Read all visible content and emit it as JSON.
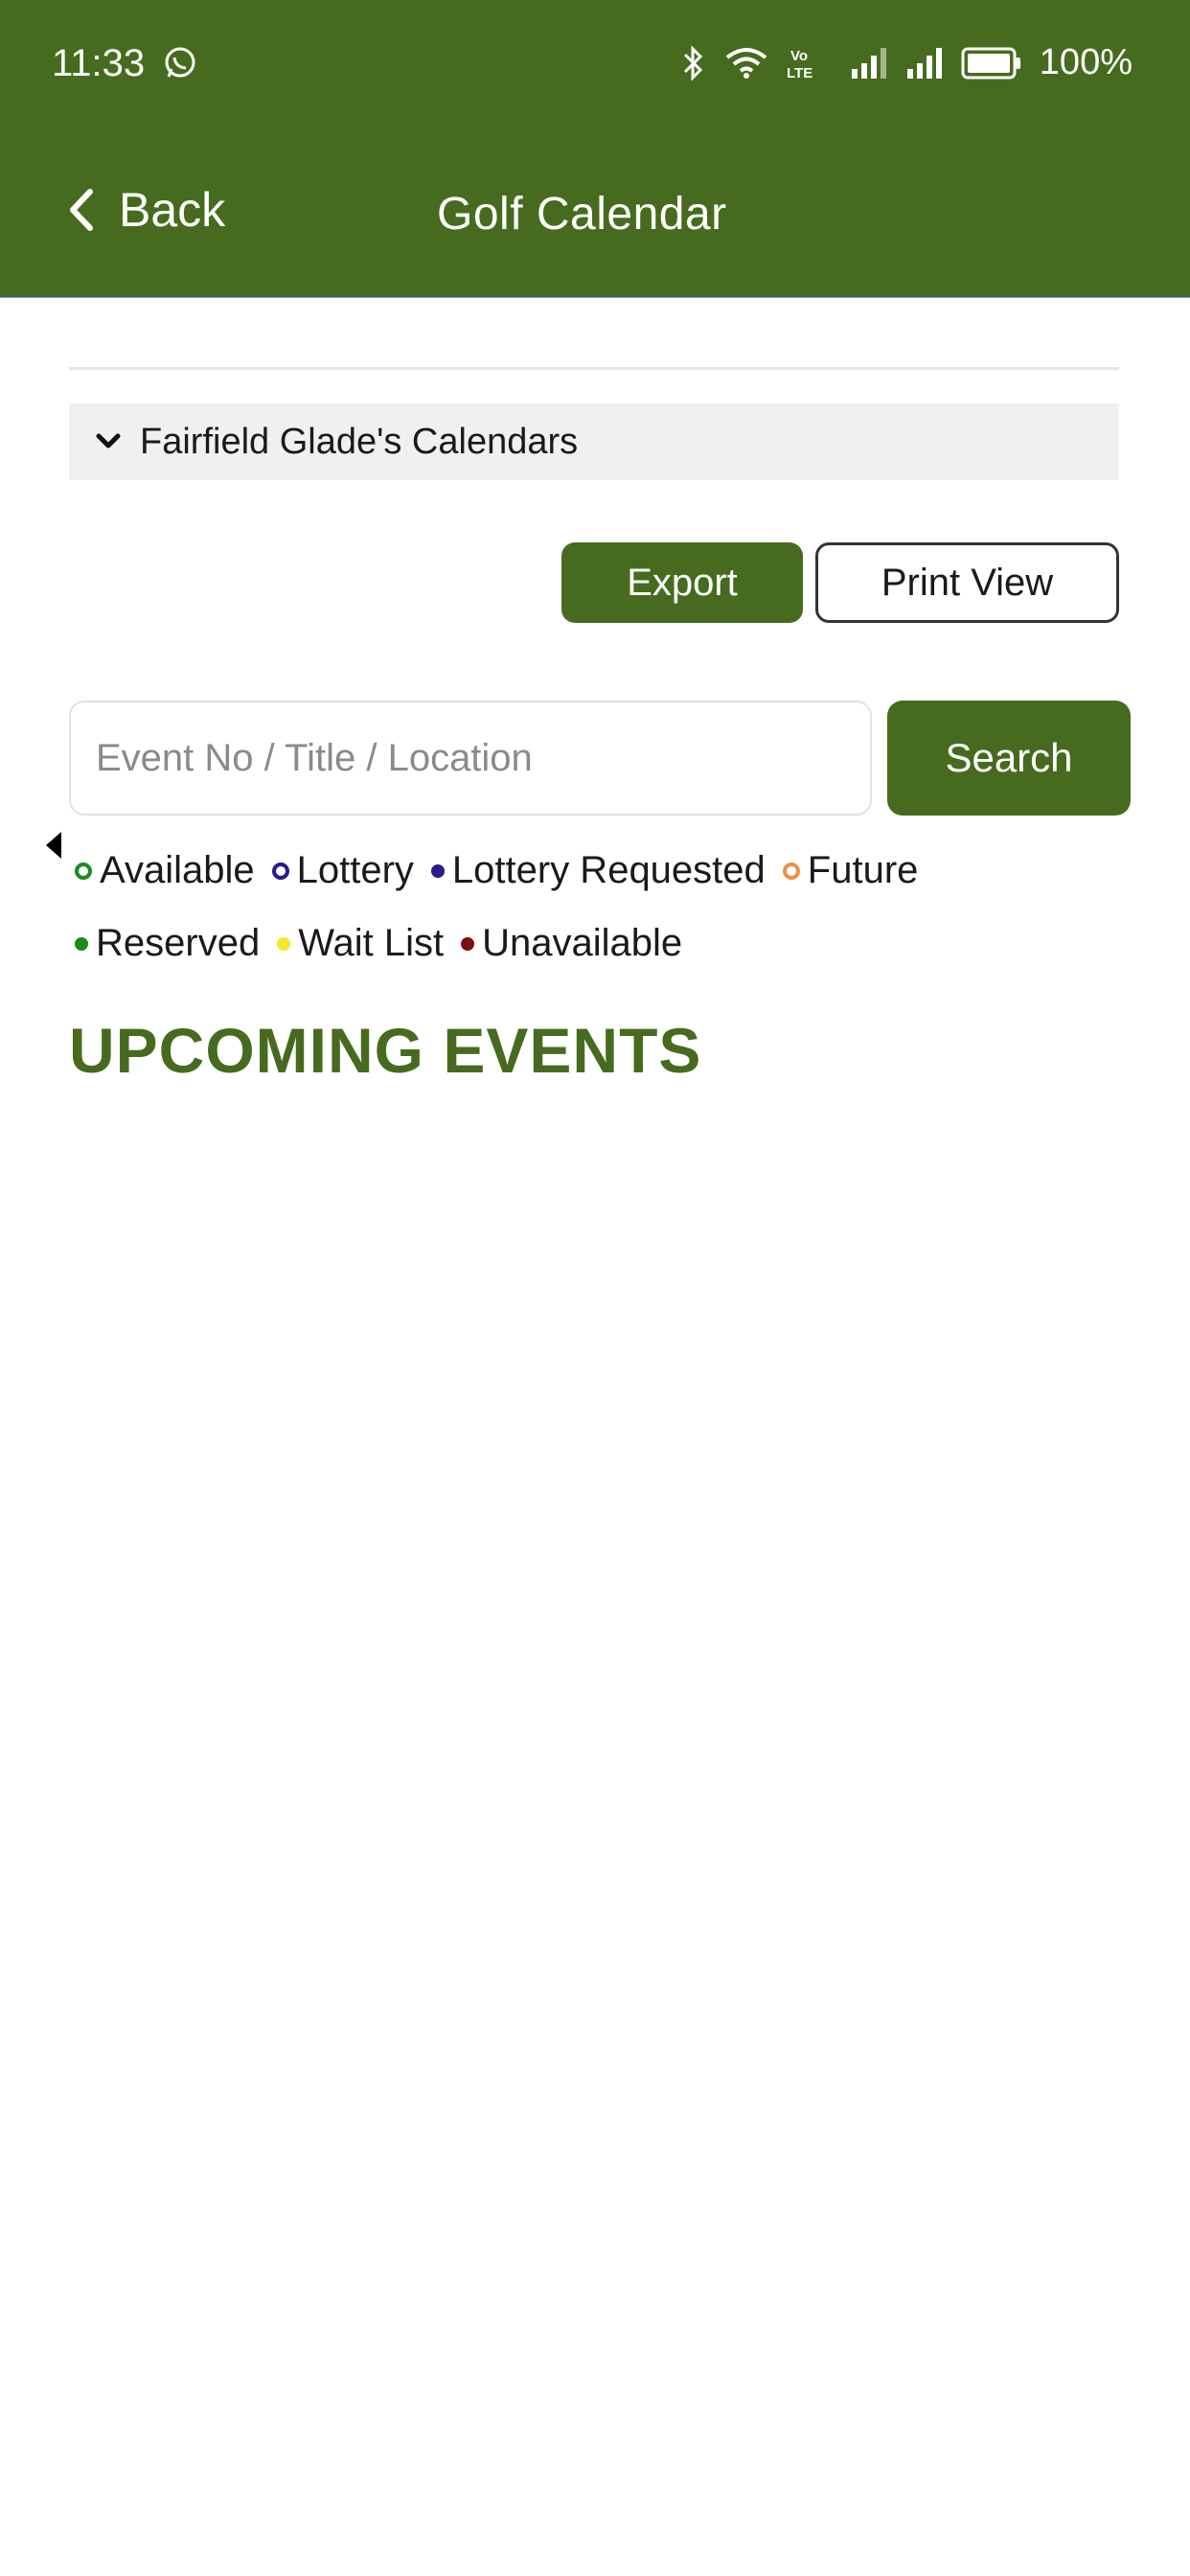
{
  "status_bar": {
    "time": "11:33",
    "battery": "100%",
    "icons": [
      "whatsapp-icon",
      "bluetooth-icon",
      "wifi-icon",
      "volte-icon",
      "signal-icon",
      "signal-icon",
      "battery-icon"
    ]
  },
  "header": {
    "back_label": "Back",
    "title": "Golf Calendar",
    "background": "#476b1e"
  },
  "accordion": {
    "label": "Fairfield Glade's Calendars"
  },
  "actions": {
    "export_label": "Export",
    "print_label": "Print View"
  },
  "search": {
    "placeholder": "Event No / Title / Location",
    "value": "",
    "button_label": "Search"
  },
  "legend": {
    "row1": [
      {
        "label": "Available",
        "color": "#1e8a1e",
        "style": "hollow"
      },
      {
        "label": "Lottery",
        "color": "#2a1a8c",
        "style": "hollow"
      },
      {
        "label": "Lottery Requested",
        "color": "#2a1a8c",
        "style": "filled"
      },
      {
        "label": "Future",
        "color": "#e8914a",
        "style": "hollow"
      }
    ],
    "row2": [
      {
        "label": "Reserved",
        "color": "#1e8a1e",
        "style": "filled"
      },
      {
        "label": "Wait List",
        "color": "#f5e62a",
        "style": "filled"
      },
      {
        "label": "Unavailable",
        "color": "#7a1010",
        "style": "filled"
      }
    ]
  },
  "section": {
    "title": "UPCOMING EVENTS"
  }
}
